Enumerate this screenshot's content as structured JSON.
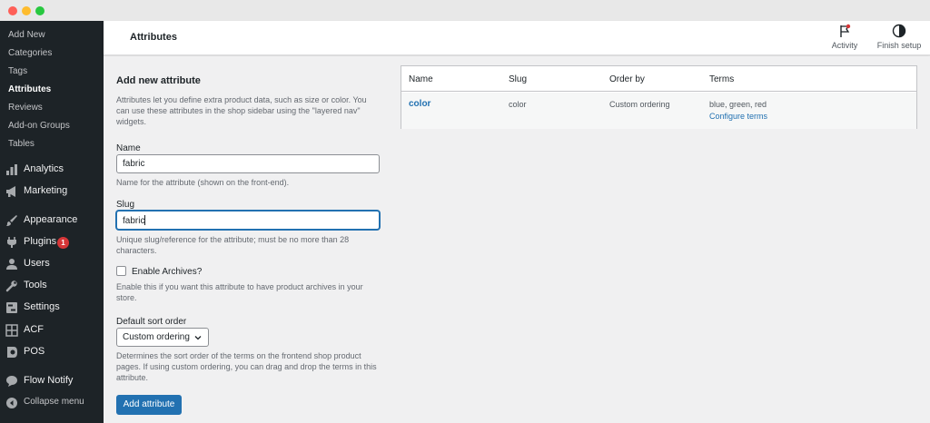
{
  "sidebar": {
    "submenu": [
      "Add New",
      "Categories",
      "Tags",
      "Attributes",
      "Reviews",
      "Add-on Groups",
      "Tables"
    ],
    "menu": [
      {
        "label": "Analytics",
        "icon": "chart-icon"
      },
      {
        "label": "Marketing",
        "icon": "megaphone-icon"
      },
      {
        "label": "Appearance",
        "icon": "brush-icon"
      },
      {
        "label": "Plugins",
        "icon": "plugin-icon",
        "badge": "1"
      },
      {
        "label": "Users",
        "icon": "user-icon"
      },
      {
        "label": "Tools",
        "icon": "wrench-icon"
      },
      {
        "label": "Settings",
        "icon": "settings-icon"
      },
      {
        "label": "ACF",
        "icon": "grid-icon"
      },
      {
        "label": "POS",
        "icon": "pos-icon"
      },
      {
        "label": "Flow Notify",
        "icon": "chat-icon"
      },
      {
        "label": "Collapse menu",
        "icon": "collapse-icon"
      }
    ]
  },
  "header": {
    "title": "Attributes",
    "activity_label": "Activity",
    "finish_setup_label": "Finish setup"
  },
  "form": {
    "title": "Add new attribute",
    "intro": "Attributes let you define extra product data, such as size or color. You can use these attributes in the shop sidebar using the \"layered nav\" widgets.",
    "name_label": "Name",
    "name_value": "fabric",
    "name_help": "Name for the attribute (shown on the front-end).",
    "slug_label": "Slug",
    "slug_value": "fabric",
    "slug_help": "Unique slug/reference for the attribute; must be no more than 28 characters.",
    "archives_label": "Enable Archives?",
    "archives_checked": false,
    "archives_help": "Enable this if you want this attribute to have product archives in your store.",
    "sort_label": "Default sort order",
    "sort_value": "Custom ordering",
    "sort_help": "Determines the sort order of the terms on the frontend shop product pages. If using custom ordering, you can drag and drop the terms in this attribute.",
    "submit_label": "Add attribute"
  },
  "table": {
    "headers": [
      "Name",
      "Slug",
      "Order by",
      "Terms"
    ],
    "rows": [
      {
        "name": "color",
        "slug": "color",
        "order_by": "Custom ordering",
        "terms": "blue, green, red",
        "configure_label": "Configure terms"
      }
    ]
  },
  "colors": {
    "accent": "#2271b1",
    "sidebar_bg": "#1d2327",
    "badge": "#d63638"
  }
}
